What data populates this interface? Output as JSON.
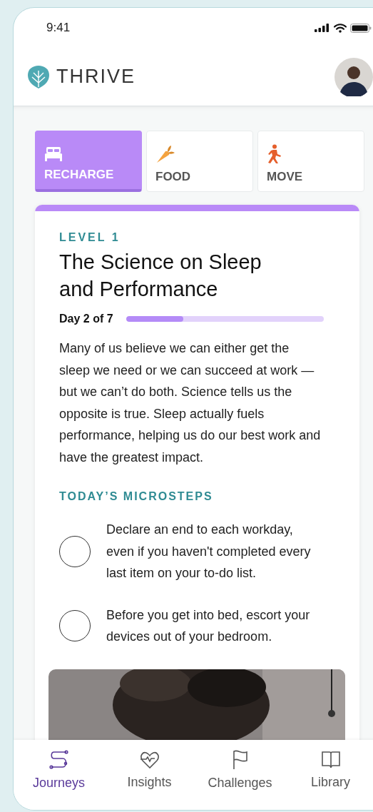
{
  "status_bar": {
    "time": "9:41"
  },
  "header": {
    "logo_text": "THRIVE"
  },
  "categories": [
    {
      "label": "RECHARGE",
      "kind": "bed",
      "selected": true
    },
    {
      "label": "FOOD",
      "kind": "carrot",
      "selected": false
    },
    {
      "label": "MOVE",
      "kind": "walk",
      "selected": false
    }
  ],
  "journey": {
    "level": "LEVEL 1",
    "title": "The Science on Sleep and Performance",
    "day": "Day 2 of 7",
    "progress": {
      "level": 0.29
    },
    "description": "Many of us believe we can either get the sleep we need or we can succeed at work — but we can’t do both. Science tells us the opposite is true. Sleep actually fuels performance, helping us do our best work and have the greatest impact.",
    "microsteps_heading": "TODAY’S MICROSTEPS",
    "microsteps": [
      {
        "text": "Declare an end to each workday, even if you haven't completed every last item on your to-do list.",
        "checked": false
      },
      {
        "text": "Before you get into bed, escort your devices out of your bedroom.",
        "checked": false
      }
    ]
  },
  "nav": [
    {
      "label": "Journeys",
      "kind": "journeys",
      "selected": true
    },
    {
      "label": "Insights",
      "kind": "insights",
      "selected": false
    },
    {
      "label": "Challenges",
      "kind": "challenges",
      "selected": false
    },
    {
      "label": "Library",
      "kind": "library",
      "selected": false
    }
  ]
}
